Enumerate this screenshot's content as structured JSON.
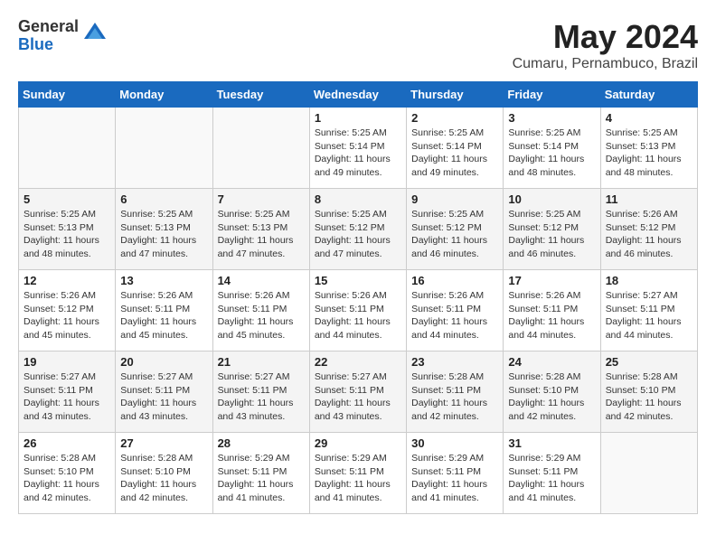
{
  "logo": {
    "general": "General",
    "blue": "Blue"
  },
  "title": "May 2024",
  "location": "Cumaru, Pernambuco, Brazil",
  "headers": [
    "Sunday",
    "Monday",
    "Tuesday",
    "Wednesday",
    "Thursday",
    "Friday",
    "Saturday"
  ],
  "weeks": [
    [
      {
        "num": "",
        "empty": true
      },
      {
        "num": "",
        "empty": true
      },
      {
        "num": "",
        "empty": true
      },
      {
        "num": "1",
        "sunrise": "5:25 AM",
        "sunset": "5:14 PM",
        "daylight": "11 hours and 49 minutes."
      },
      {
        "num": "2",
        "sunrise": "5:25 AM",
        "sunset": "5:14 PM",
        "daylight": "11 hours and 49 minutes."
      },
      {
        "num": "3",
        "sunrise": "5:25 AM",
        "sunset": "5:14 PM",
        "daylight": "11 hours and 48 minutes."
      },
      {
        "num": "4",
        "sunrise": "5:25 AM",
        "sunset": "5:13 PM",
        "daylight": "11 hours and 48 minutes."
      }
    ],
    [
      {
        "num": "5",
        "sunrise": "5:25 AM",
        "sunset": "5:13 PM",
        "daylight": "11 hours and 48 minutes."
      },
      {
        "num": "6",
        "sunrise": "5:25 AM",
        "sunset": "5:13 PM",
        "daylight": "11 hours and 47 minutes."
      },
      {
        "num": "7",
        "sunrise": "5:25 AM",
        "sunset": "5:13 PM",
        "daylight": "11 hours and 47 minutes."
      },
      {
        "num": "8",
        "sunrise": "5:25 AM",
        "sunset": "5:12 PM",
        "daylight": "11 hours and 47 minutes."
      },
      {
        "num": "9",
        "sunrise": "5:25 AM",
        "sunset": "5:12 PM",
        "daylight": "11 hours and 46 minutes."
      },
      {
        "num": "10",
        "sunrise": "5:25 AM",
        "sunset": "5:12 PM",
        "daylight": "11 hours and 46 minutes."
      },
      {
        "num": "11",
        "sunrise": "5:26 AM",
        "sunset": "5:12 PM",
        "daylight": "11 hours and 46 minutes."
      }
    ],
    [
      {
        "num": "12",
        "sunrise": "5:26 AM",
        "sunset": "5:12 PM",
        "daylight": "11 hours and 45 minutes."
      },
      {
        "num": "13",
        "sunrise": "5:26 AM",
        "sunset": "5:11 PM",
        "daylight": "11 hours and 45 minutes."
      },
      {
        "num": "14",
        "sunrise": "5:26 AM",
        "sunset": "5:11 PM",
        "daylight": "11 hours and 45 minutes."
      },
      {
        "num": "15",
        "sunrise": "5:26 AM",
        "sunset": "5:11 PM",
        "daylight": "11 hours and 44 minutes."
      },
      {
        "num": "16",
        "sunrise": "5:26 AM",
        "sunset": "5:11 PM",
        "daylight": "11 hours and 44 minutes."
      },
      {
        "num": "17",
        "sunrise": "5:26 AM",
        "sunset": "5:11 PM",
        "daylight": "11 hours and 44 minutes."
      },
      {
        "num": "18",
        "sunrise": "5:27 AM",
        "sunset": "5:11 PM",
        "daylight": "11 hours and 44 minutes."
      }
    ],
    [
      {
        "num": "19",
        "sunrise": "5:27 AM",
        "sunset": "5:11 PM",
        "daylight": "11 hours and 43 minutes."
      },
      {
        "num": "20",
        "sunrise": "5:27 AM",
        "sunset": "5:11 PM",
        "daylight": "11 hours and 43 minutes."
      },
      {
        "num": "21",
        "sunrise": "5:27 AM",
        "sunset": "5:11 PM",
        "daylight": "11 hours and 43 minutes."
      },
      {
        "num": "22",
        "sunrise": "5:27 AM",
        "sunset": "5:11 PM",
        "daylight": "11 hours and 43 minutes."
      },
      {
        "num": "23",
        "sunrise": "5:28 AM",
        "sunset": "5:11 PM",
        "daylight": "11 hours and 42 minutes."
      },
      {
        "num": "24",
        "sunrise": "5:28 AM",
        "sunset": "5:10 PM",
        "daylight": "11 hours and 42 minutes."
      },
      {
        "num": "25",
        "sunrise": "5:28 AM",
        "sunset": "5:10 PM",
        "daylight": "11 hours and 42 minutes."
      }
    ],
    [
      {
        "num": "26",
        "sunrise": "5:28 AM",
        "sunset": "5:10 PM",
        "daylight": "11 hours and 42 minutes."
      },
      {
        "num": "27",
        "sunrise": "5:28 AM",
        "sunset": "5:10 PM",
        "daylight": "11 hours and 42 minutes."
      },
      {
        "num": "28",
        "sunrise": "5:29 AM",
        "sunset": "5:11 PM",
        "daylight": "11 hours and 41 minutes."
      },
      {
        "num": "29",
        "sunrise": "5:29 AM",
        "sunset": "5:11 PM",
        "daylight": "11 hours and 41 minutes."
      },
      {
        "num": "30",
        "sunrise": "5:29 AM",
        "sunset": "5:11 PM",
        "daylight": "11 hours and 41 minutes."
      },
      {
        "num": "31",
        "sunrise": "5:29 AM",
        "sunset": "5:11 PM",
        "daylight": "11 hours and 41 minutes."
      },
      {
        "num": "",
        "empty": true
      }
    ]
  ]
}
